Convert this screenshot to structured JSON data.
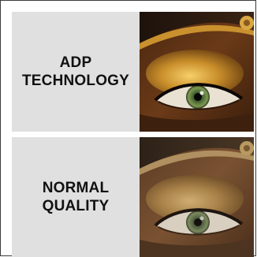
{
  "panels": [
    {
      "label_line1": "ADP",
      "label_line2": "TECHNOLOGY",
      "image": "eye-closeup-vivid"
    },
    {
      "label_line1": "NORMAL",
      "label_line2": "QUALITY",
      "image": "eye-closeup-dull"
    }
  ]
}
